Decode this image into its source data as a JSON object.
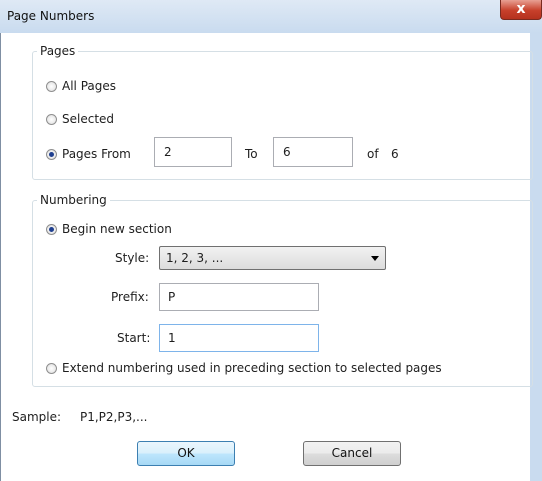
{
  "window": {
    "title": "Page Numbers",
    "close_glyph": "x"
  },
  "pages_group": {
    "legend": "Pages",
    "all_pages_label": "All Pages",
    "selected_label": "Selected",
    "pages_from_label": "Pages From",
    "from_value": "2",
    "to_label": "To",
    "to_value": "6",
    "of_label": "of",
    "total_pages": "6",
    "selected_option": "pages_from"
  },
  "numbering_group": {
    "legend": "Numbering",
    "begin_new_section_label": "Begin new section",
    "style_label": "Style:",
    "style_value": "1, 2, 3, ...",
    "prefix_label": "Prefix:",
    "prefix_value": "P",
    "start_label": "Start:",
    "start_value": "1",
    "extend_label": "Extend numbering used in preceding section to selected pages",
    "selected_option": "begin_new_section"
  },
  "sample": {
    "label": "Sample:",
    "value": "P1,P2,P3,..."
  },
  "buttons": {
    "ok_label": "OK",
    "cancel_label": "Cancel"
  }
}
